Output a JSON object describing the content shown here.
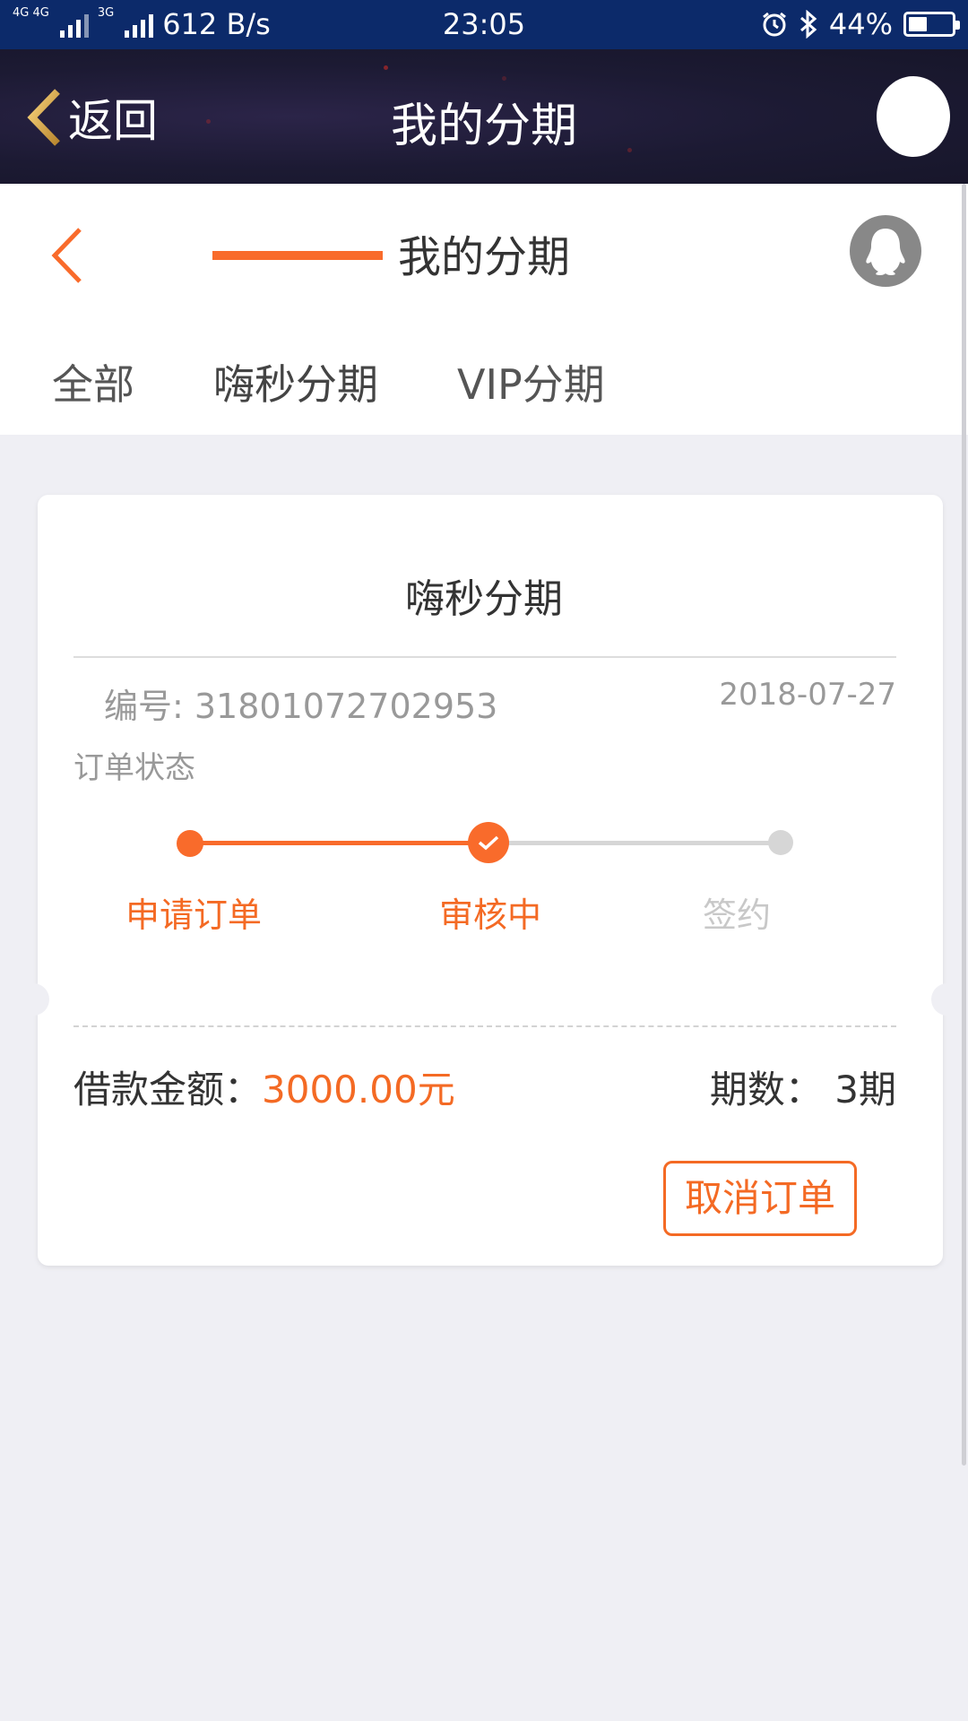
{
  "status_bar": {
    "network_1": "4G 4G",
    "network_2": "3G",
    "speed": "612 B/s",
    "time": "23:05",
    "battery_percent": "44%",
    "battery_level": 0.44
  },
  "app_header": {
    "back_label": "返回",
    "title": "我的分期"
  },
  "page_nav": {
    "title": "我的分期"
  },
  "tabs": [
    {
      "label": "全部"
    },
    {
      "label": "嗨秒分期",
      "active": true
    },
    {
      "label": "VIP分期"
    }
  ],
  "order_card": {
    "title": "嗨秒分期",
    "order_number": "编号: 31801072702953",
    "date": "2018-07-27",
    "status_label": "订单状态",
    "steps": [
      {
        "label": "申请订单",
        "state": "done"
      },
      {
        "label": "审核中",
        "state": "current"
      },
      {
        "label": "签约",
        "state": "pending"
      }
    ],
    "loan_label": "借款金额：",
    "loan_amount": "3000.00元",
    "periods_label": "期数：",
    "periods_value": "3期",
    "cancel_button": "取消订单"
  },
  "colors": {
    "accent": "#f96b2b",
    "status_bar": "#0c2a6a",
    "header_dark": "#1c1a33",
    "background": "#efeff4"
  },
  "icons": {
    "back_gold": "chevron-left-icon",
    "back_orange": "chevron-left-icon",
    "qq": "qq-penguin-icon",
    "check": "check-icon"
  }
}
